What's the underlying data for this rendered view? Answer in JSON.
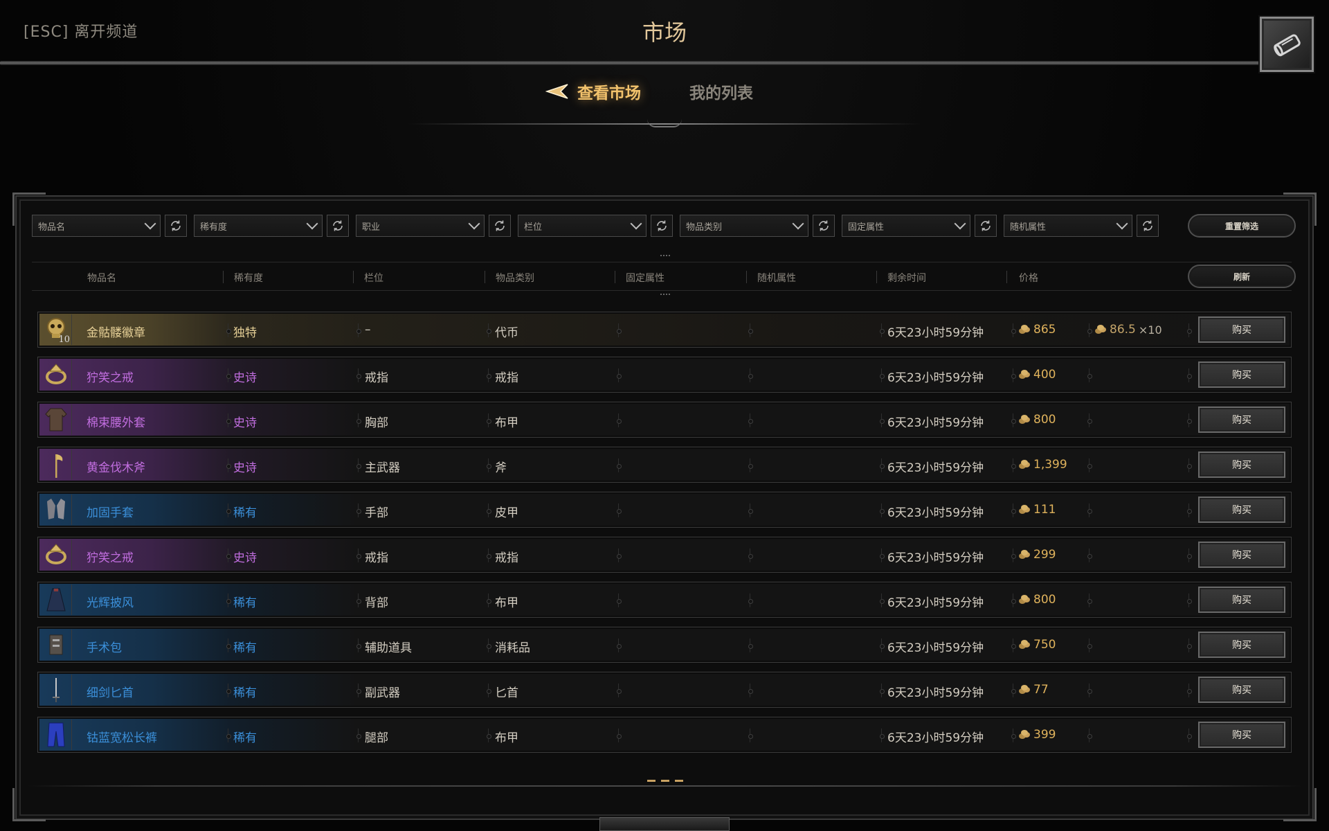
{
  "header": {
    "esc_label": "[ESC] 离开频道",
    "title": "市场"
  },
  "tabs": [
    {
      "label": "查看市场",
      "active": true
    },
    {
      "label": "我的列表",
      "active": false
    }
  ],
  "filters": [
    {
      "label": "物品名"
    },
    {
      "label": "稀有度"
    },
    {
      "label": "职业"
    },
    {
      "label": "栏位"
    },
    {
      "label": "物品类别"
    },
    {
      "label": "固定属性"
    },
    {
      "label": "随机属性"
    }
  ],
  "reset_label": "重置筛选",
  "refresh_label": "刷新",
  "columns": [
    "物品名",
    "稀有度",
    "栏位",
    "物品类别",
    "固定属性",
    "随机属性",
    "剩余时间",
    "价格"
  ],
  "colors": {
    "unique": "#e5cf96",
    "epic": "#c26ee0",
    "rare": "#3b8fd9",
    "gold": "#e0b35c"
  },
  "rows": [
    {
      "icon": "gold-skull-icon",
      "badge": "10",
      "name": "金骷髅徽章",
      "rarity": "独特",
      "tier": "unique",
      "slot": "–",
      "category": "代币",
      "fixed": "",
      "random": "",
      "time": "6天23小时59分钟",
      "price": "865",
      "unit_price": "86.5",
      "qty": "×10",
      "buy": "购买"
    },
    {
      "icon": "ring-icon",
      "badge": "",
      "name": "狞笑之戒",
      "rarity": "史诗",
      "tier": "epic",
      "slot": "戒指",
      "category": "戒指",
      "fixed": "",
      "random": "",
      "time": "6天23小时59分钟",
      "price": "400",
      "unit_price": "",
      "qty": "",
      "buy": "购买"
    },
    {
      "icon": "jacket-icon",
      "badge": "",
      "name": "棉束腰外套",
      "rarity": "史诗",
      "tier": "epic",
      "slot": "胸部",
      "category": "布甲",
      "fixed": "",
      "random": "",
      "time": "6天23小时59分钟",
      "price": "800",
      "unit_price": "",
      "qty": "",
      "buy": "购买"
    },
    {
      "icon": "axe-icon",
      "badge": "",
      "name": "黄金伐木斧",
      "rarity": "史诗",
      "tier": "epic",
      "slot": "主武器",
      "category": "斧",
      "fixed": "",
      "random": "",
      "time": "6天23小时59分钟",
      "price": "1,399",
      "unit_price": "",
      "qty": "",
      "buy": "购买"
    },
    {
      "icon": "gloves-icon",
      "badge": "",
      "name": "加固手套",
      "rarity": "稀有",
      "tier": "rare",
      "slot": "手部",
      "category": "皮甲",
      "fixed": "",
      "random": "",
      "time": "6天23小时59分钟",
      "price": "111",
      "unit_price": "",
      "qty": "",
      "buy": "购买"
    },
    {
      "icon": "ring-icon",
      "badge": "",
      "name": "狞笑之戒",
      "rarity": "史诗",
      "tier": "epic",
      "slot": "戒指",
      "category": "戒指",
      "fixed": "",
      "random": "",
      "time": "6天23小时59分钟",
      "price": "299",
      "unit_price": "",
      "qty": "",
      "buy": "购买"
    },
    {
      "icon": "cloak-icon",
      "badge": "",
      "name": "光辉披风",
      "rarity": "稀有",
      "tier": "rare",
      "slot": "背部",
      "category": "布甲",
      "fixed": "",
      "random": "",
      "time": "6天23小时59分钟",
      "price": "800",
      "unit_price": "",
      "qty": "",
      "buy": "购买"
    },
    {
      "icon": "surgical-kit-icon",
      "badge": "",
      "name": "手术包",
      "rarity": "稀有",
      "tier": "rare",
      "slot": "辅助道具",
      "category": "消耗品",
      "fixed": "",
      "random": "",
      "time": "6天23小时59分钟",
      "price": "750",
      "unit_price": "",
      "qty": "",
      "buy": "购买"
    },
    {
      "icon": "dagger-icon",
      "badge": "",
      "name": "细剑匕首",
      "rarity": "稀有",
      "tier": "rare",
      "slot": "副武器",
      "category": "匕首",
      "fixed": "",
      "random": "",
      "time": "6天23小时59分钟",
      "price": "77",
      "unit_price": "",
      "qty": "",
      "buy": "购买"
    },
    {
      "icon": "trousers-icon",
      "badge": "",
      "name": "钴蓝宽松长裤",
      "rarity": "稀有",
      "tier": "rare",
      "slot": "腿部",
      "category": "布甲",
      "fixed": "",
      "random": "",
      "time": "6天23小时59分钟",
      "price": "399",
      "unit_price": "",
      "qty": "",
      "buy": "购买"
    }
  ]
}
